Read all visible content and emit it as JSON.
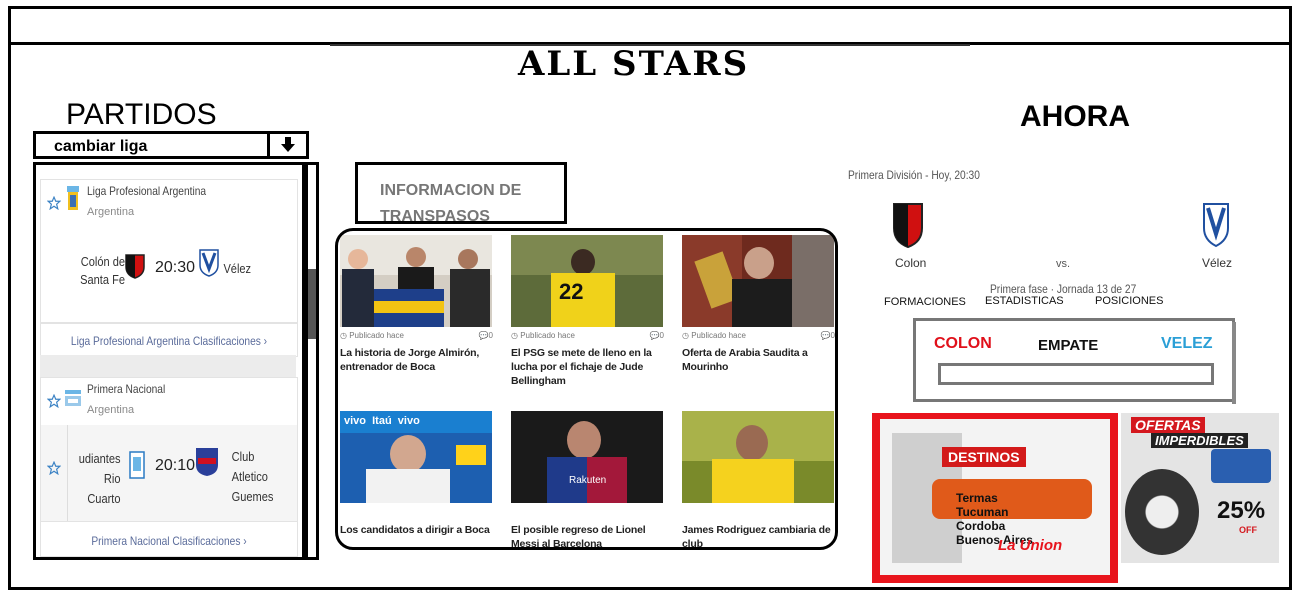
{
  "site": {
    "title": "ALL STARS"
  },
  "sections": {
    "matches_heading": "PARTIDOS",
    "now_heading": "AHORA"
  },
  "league_selector": {
    "label": "cambiar liga",
    "icon": "arrow-down-icon"
  },
  "leagues": [
    {
      "name": "Liga Profesional Argentina",
      "country": "Argentina",
      "match": {
        "home": "Colón de Santa Fe",
        "time": "20:30",
        "away": "Vélez"
      },
      "standings_link": "Liga Profesional Argentina Clasificaciones ›"
    },
    {
      "name": "Primera Nacional",
      "country": "Argentina",
      "match": {
        "home": "udiantes Rio Cuarto",
        "time": "20:10",
        "away": "Club Atletico Guemes"
      },
      "standings_link": "Primera Nacional Clasificaciones ›"
    }
  ],
  "transfers": {
    "heading": "INFORMACION DE TRANSPASOS",
    "published_label": "Publicado hace",
    "comments": "0",
    "items": [
      {
        "headline": "La historia de Jorge Almirón, entrenador de Boca"
      },
      {
        "headline": "El PSG se mete de lleno en la lucha por el fichaje de Jude Bellingham"
      },
      {
        "headline": "Oferta de Arabia Saudita a Mourinho"
      },
      {
        "headline": "Los candidatos a dirigir a Boca"
      },
      {
        "headline": "El posible regreso de Lionel Messi al Barcelona"
      },
      {
        "headline": "James Rodriguez cambiaria de club"
      }
    ]
  },
  "live_match": {
    "competition": "Primera División - Hoy, 20:30",
    "home": "Colon",
    "away": "Vélez",
    "vs": "vs.",
    "stage": "Primera fase · Jornada 13 de 27",
    "tabs": [
      "FORMACIONES",
      "ESTADISTICAS",
      "POSICIONES"
    ]
  },
  "prediction": {
    "home": "COLON",
    "draw": "EMPATE",
    "away": "VELEZ",
    "home_color": "#e0101a",
    "away_color": "#2a9fd6"
  },
  "ads": [
    {
      "brand": "La Unión",
      "heading": "DESTINOS",
      "lines": [
        "Termas",
        "Tucuman",
        "Cordoba",
        "Buenos Aires"
      ],
      "logo_text": "La Union"
    },
    {
      "heading1": "OFERTAS",
      "heading2": "IMPERDIBLES",
      "discount": "25%",
      "discount_suffix": "OFF"
    }
  ]
}
